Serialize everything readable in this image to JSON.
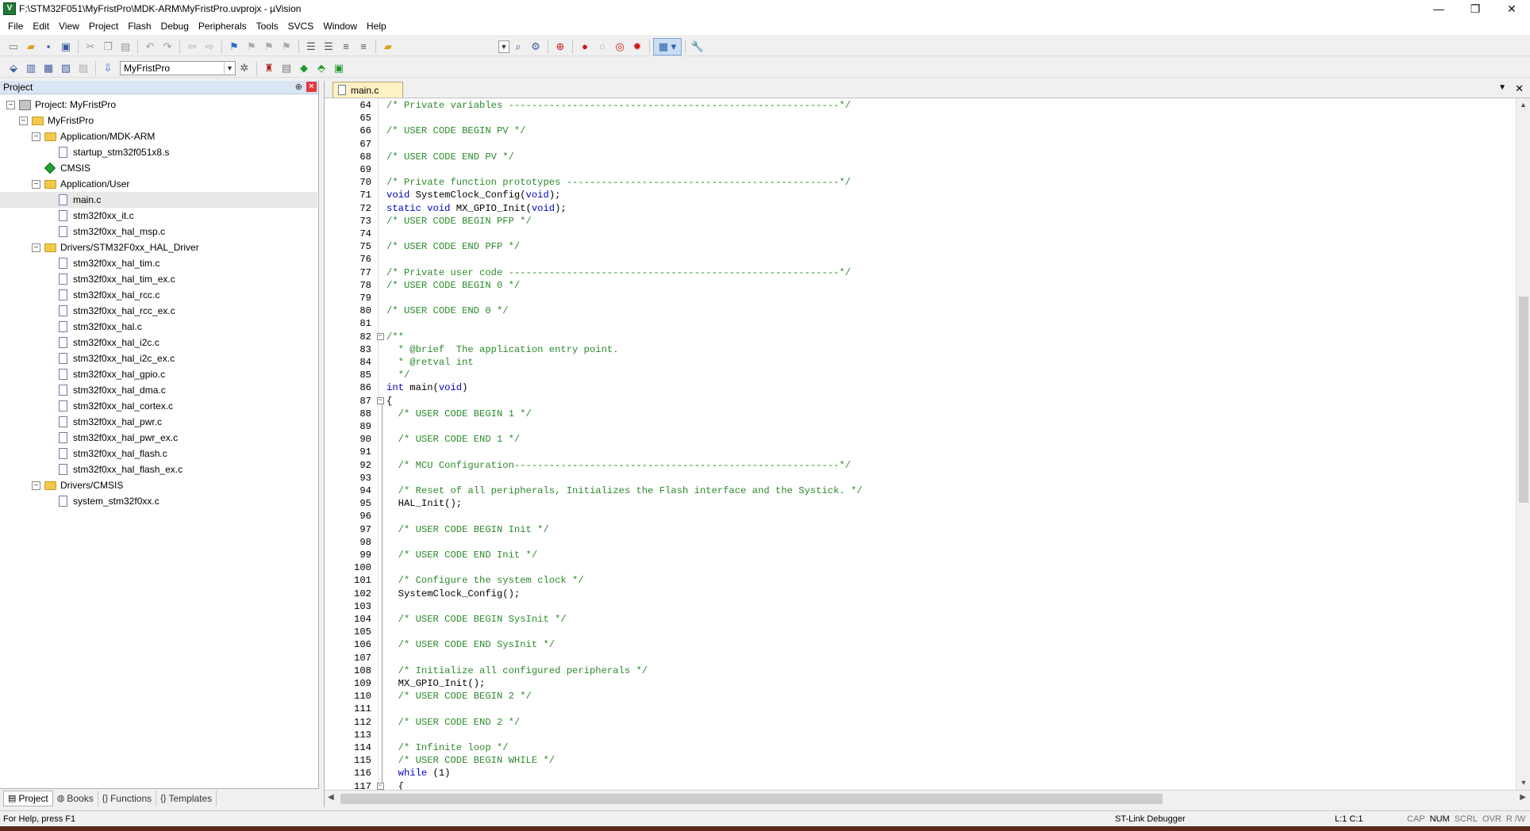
{
  "window": {
    "title": "F:\\STM32F051\\MyFristPro\\MDK-ARM\\MyFristPro.uvprojx - µVision",
    "app_icon": "V",
    "minimize": "—",
    "restore": "❐",
    "close": "✕"
  },
  "menu": [
    "File",
    "Edit",
    "View",
    "Project",
    "Flash",
    "Debug",
    "Peripherals",
    "Tools",
    "SVCS",
    "Window",
    "Help"
  ],
  "toolbar2": {
    "target_select": "MyFristPro"
  },
  "project_panel": {
    "title": "Project",
    "pin": "⊕",
    "close": "✕",
    "tree": [
      {
        "level": 0,
        "toggle": "−",
        "icon": "proj",
        "label": "Project: MyFristPro"
      },
      {
        "level": 1,
        "toggle": "−",
        "icon": "folder",
        "label": "MyFristPro"
      },
      {
        "level": 2,
        "toggle": "−",
        "icon": "folder",
        "label": "Application/MDK-ARM"
      },
      {
        "level": 3,
        "toggle": "",
        "icon": "file",
        "label": "startup_stm32f051x8.s"
      },
      {
        "level": 2,
        "toggle": "",
        "icon": "diamond",
        "label": "CMSIS"
      },
      {
        "level": 2,
        "toggle": "−",
        "icon": "folder",
        "label": "Application/User"
      },
      {
        "level": 3,
        "toggle": "",
        "icon": "file",
        "label": "main.c",
        "selected": true
      },
      {
        "level": 3,
        "toggle": "",
        "icon": "file",
        "label": "stm32f0xx_it.c"
      },
      {
        "level": 3,
        "toggle": "",
        "icon": "file",
        "label": "stm32f0xx_hal_msp.c"
      },
      {
        "level": 2,
        "toggle": "−",
        "icon": "folder",
        "label": "Drivers/STM32F0xx_HAL_Driver"
      },
      {
        "level": 3,
        "toggle": "",
        "icon": "file",
        "label": "stm32f0xx_hal_tim.c"
      },
      {
        "level": 3,
        "toggle": "",
        "icon": "file",
        "label": "stm32f0xx_hal_tim_ex.c"
      },
      {
        "level": 3,
        "toggle": "",
        "icon": "file",
        "label": "stm32f0xx_hal_rcc.c"
      },
      {
        "level": 3,
        "toggle": "",
        "icon": "file",
        "label": "stm32f0xx_hal_rcc_ex.c"
      },
      {
        "level": 3,
        "toggle": "",
        "icon": "file",
        "label": "stm32f0xx_hal.c"
      },
      {
        "level": 3,
        "toggle": "",
        "icon": "file",
        "label": "stm32f0xx_hal_i2c.c"
      },
      {
        "level": 3,
        "toggle": "",
        "icon": "file",
        "label": "stm32f0xx_hal_i2c_ex.c"
      },
      {
        "level": 3,
        "toggle": "",
        "icon": "file",
        "label": "stm32f0xx_hal_gpio.c"
      },
      {
        "level": 3,
        "toggle": "",
        "icon": "file",
        "label": "stm32f0xx_hal_dma.c"
      },
      {
        "level": 3,
        "toggle": "",
        "icon": "file",
        "label": "stm32f0xx_hal_cortex.c"
      },
      {
        "level": 3,
        "toggle": "",
        "icon": "file",
        "label": "stm32f0xx_hal_pwr.c"
      },
      {
        "level": 3,
        "toggle": "",
        "icon": "file",
        "label": "stm32f0xx_hal_pwr_ex.c"
      },
      {
        "level": 3,
        "toggle": "",
        "icon": "file",
        "label": "stm32f0xx_hal_flash.c"
      },
      {
        "level": 3,
        "toggle": "",
        "icon": "file",
        "label": "stm32f0xx_hal_flash_ex.c"
      },
      {
        "level": 2,
        "toggle": "−",
        "icon": "folder",
        "label": "Drivers/CMSIS"
      },
      {
        "level": 3,
        "toggle": "",
        "icon": "file",
        "label": "system_stm32f0xx.c"
      }
    ],
    "tabs": [
      {
        "icon": "▤",
        "label": "Project",
        "active": true
      },
      {
        "icon": "◍",
        "label": "Books"
      },
      {
        "icon": "{}",
        "label": "Functions"
      },
      {
        "icon": "{}",
        "label": "Templates"
      }
    ]
  },
  "editor": {
    "tab_label": "main.c",
    "dropdown": "▼",
    "close": "✕",
    "lines": [
      {
        "n": "64",
        "seg": [
          [
            "cm",
            "/* Private variables ---------------------------------------------------------*/"
          ]
        ]
      },
      {
        "n": "65",
        "seg": []
      },
      {
        "n": "66",
        "seg": [
          [
            "cm",
            "/* USER CODE BEGIN PV */"
          ]
        ]
      },
      {
        "n": "67",
        "seg": []
      },
      {
        "n": "68",
        "seg": [
          [
            "cm",
            "/* USER CODE END PV */"
          ]
        ]
      },
      {
        "n": "69",
        "seg": []
      },
      {
        "n": "70",
        "seg": [
          [
            "cm",
            "/* Private function prototypes -----------------------------------------------*/"
          ]
        ]
      },
      {
        "n": "71",
        "seg": [
          [
            "kw",
            "void"
          ],
          [
            "pl",
            " SystemClock_Config("
          ],
          [
            "kw",
            "void"
          ],
          [
            "pl",
            ");"
          ]
        ]
      },
      {
        "n": "72",
        "seg": [
          [
            "kw",
            "static void"
          ],
          [
            "pl",
            " MX_GPIO_Init("
          ],
          [
            "kw",
            "void"
          ],
          [
            "pl",
            ");"
          ]
        ]
      },
      {
        "n": "73",
        "seg": [
          [
            "cm",
            "/* USER CODE BEGIN PFP */"
          ]
        ]
      },
      {
        "n": "74",
        "seg": []
      },
      {
        "n": "75",
        "seg": [
          [
            "cm",
            "/* USER CODE END PFP */"
          ]
        ]
      },
      {
        "n": "76",
        "seg": []
      },
      {
        "n": "77",
        "seg": [
          [
            "cm",
            "/* Private user code ---------------------------------------------------------*/"
          ]
        ]
      },
      {
        "n": "78",
        "seg": [
          [
            "cm",
            "/* USER CODE BEGIN 0 */"
          ]
        ]
      },
      {
        "n": "79",
        "seg": []
      },
      {
        "n": "80",
        "seg": [
          [
            "cm",
            "/* USER CODE END 0 */"
          ]
        ]
      },
      {
        "n": "81",
        "seg": []
      },
      {
        "n": "82",
        "fold": "−",
        "seg": [
          [
            "cm",
            "/**"
          ]
        ]
      },
      {
        "n": "83",
        "seg": [
          [
            "cm",
            "  * @brief  The application entry point."
          ]
        ]
      },
      {
        "n": "84",
        "seg": [
          [
            "cm",
            "  * @retval int"
          ]
        ]
      },
      {
        "n": "85",
        "seg": [
          [
            "cm",
            "  */"
          ]
        ]
      },
      {
        "n": "86",
        "seg": [
          [
            "kw",
            "int"
          ],
          [
            "pl",
            " main("
          ],
          [
            "kw",
            "void"
          ],
          [
            "pl",
            ")"
          ]
        ]
      },
      {
        "n": "87",
        "fold": "−",
        "seg": [
          [
            "pl",
            "{"
          ]
        ]
      },
      {
        "n": "88",
        "seg": [
          [
            "cm",
            "  /* USER CODE BEGIN 1 */"
          ]
        ]
      },
      {
        "n": "89",
        "seg": []
      },
      {
        "n": "90",
        "seg": [
          [
            "cm",
            "  /* USER CODE END 1 */"
          ]
        ]
      },
      {
        "n": "91",
        "seg": []
      },
      {
        "n": "92",
        "seg": [
          [
            "cm",
            "  /* MCU Configuration--------------------------------------------------------*/"
          ]
        ]
      },
      {
        "n": "93",
        "seg": []
      },
      {
        "n": "94",
        "seg": [
          [
            "cm",
            "  /* Reset of all peripherals, Initializes the Flash interface and the Systick. */"
          ]
        ]
      },
      {
        "n": "95",
        "seg": [
          [
            "pl",
            "  HAL_Init();"
          ]
        ]
      },
      {
        "n": "96",
        "seg": []
      },
      {
        "n": "97",
        "seg": [
          [
            "cm",
            "  /* USER CODE BEGIN Init */"
          ]
        ]
      },
      {
        "n": "98",
        "seg": []
      },
      {
        "n": "99",
        "seg": [
          [
            "cm",
            "  /* USER CODE END Init */"
          ]
        ]
      },
      {
        "n": "100",
        "seg": []
      },
      {
        "n": "101",
        "seg": [
          [
            "cm",
            "  /* Configure the system clock */"
          ]
        ]
      },
      {
        "n": "102",
        "seg": [
          [
            "pl",
            "  SystemClock_Config();"
          ]
        ]
      },
      {
        "n": "103",
        "seg": []
      },
      {
        "n": "104",
        "seg": [
          [
            "cm",
            "  /* USER CODE BEGIN SysInit */"
          ]
        ]
      },
      {
        "n": "105",
        "seg": []
      },
      {
        "n": "106",
        "seg": [
          [
            "cm",
            "  /* USER CODE END SysInit */"
          ]
        ]
      },
      {
        "n": "107",
        "seg": []
      },
      {
        "n": "108",
        "seg": [
          [
            "cm",
            "  /* Initialize all configured peripherals */"
          ]
        ]
      },
      {
        "n": "109",
        "seg": [
          [
            "pl",
            "  MX_GPIO_Init();"
          ]
        ]
      },
      {
        "n": "110",
        "seg": [
          [
            "cm",
            "  /* USER CODE BEGIN 2 */"
          ]
        ]
      },
      {
        "n": "111",
        "seg": []
      },
      {
        "n": "112",
        "seg": [
          [
            "cm",
            "  /* USER CODE END 2 */"
          ]
        ]
      },
      {
        "n": "113",
        "seg": []
      },
      {
        "n": "114",
        "seg": [
          [
            "cm",
            "  /* Infinite loop */"
          ]
        ]
      },
      {
        "n": "115",
        "seg": [
          [
            "cm",
            "  /* USER CODE BEGIN WHILE */"
          ]
        ]
      },
      {
        "n": "116",
        "seg": [
          [
            "pl",
            "  "
          ],
          [
            "kw",
            "while"
          ],
          [
            "pl",
            " (1)"
          ]
        ]
      },
      {
        "n": "117",
        "fold": "−",
        "seg": [
          [
            "pl",
            "  {"
          ]
        ]
      }
    ]
  },
  "status": {
    "help": "For Help, press F1",
    "debugger": "ST-Link Debugger",
    "position": "L:1 C:1",
    "keys": [
      {
        "label": "CAP",
        "on": false
      },
      {
        "label": "NUM",
        "on": true
      },
      {
        "label": "SCRL",
        "on": false
      },
      {
        "label": "OVR",
        "on": false
      },
      {
        "label": "R /W",
        "on": false
      }
    ]
  },
  "colors": {
    "comment": "#2d8a2d",
    "keyword": "#0000c8",
    "tab_active": "#fff2c4",
    "panel_header": "#dbe6f4"
  }
}
